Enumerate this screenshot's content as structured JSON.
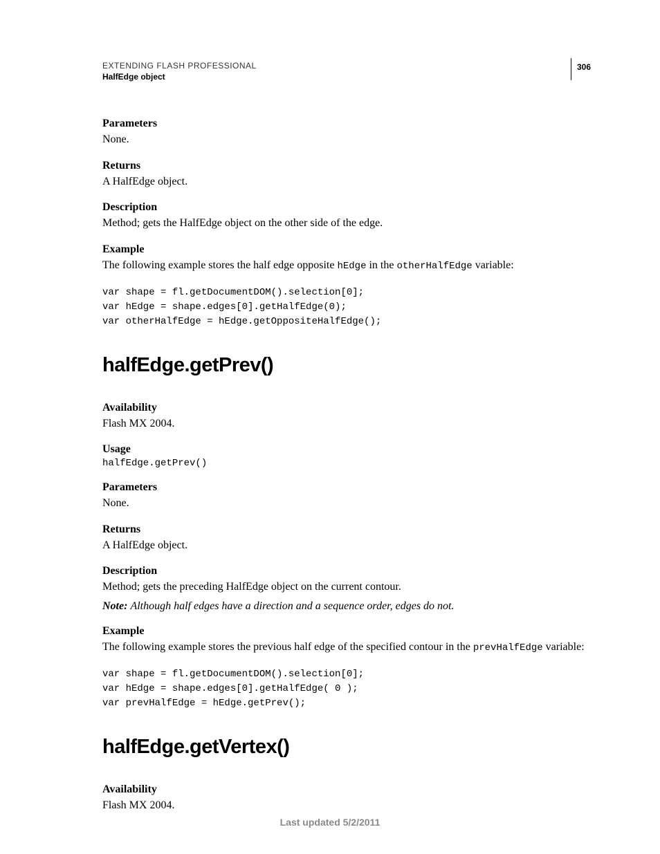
{
  "header": {
    "running_head": "EXTENDING FLASH PROFESSIONAL",
    "running_sub": "HalfEdge object",
    "page_number": "306"
  },
  "section1": {
    "parameters_label": "Parameters",
    "parameters_body": "None.",
    "returns_label": "Returns",
    "returns_body": "A HalfEdge object.",
    "description_label": "Description",
    "description_body": "Method; gets the HalfEdge object on the other side of the edge.",
    "example_label": "Example",
    "example_lead_pre": "The following example stores the half edge opposite ",
    "example_code1": "hEdge",
    "example_mid": " in the ",
    "example_code2": "otherHalfEdge",
    "example_post": " variable:",
    "code": "var shape = fl.getDocumentDOM().selection[0]; \nvar hEdge = shape.edges[0].getHalfEdge(0); \nvar otherHalfEdge = hEdge.getOppositeHalfEdge();"
  },
  "method2": {
    "title": "halfEdge.getPrev()",
    "availability_label": "Availability",
    "availability_body": "Flash MX 2004.",
    "usage_label": "Usage",
    "usage_code": "halfEdge.getPrev()",
    "parameters_label": "Parameters",
    "parameters_body": "None.",
    "returns_label": "Returns",
    "returns_body": "A HalfEdge object.",
    "description_label": "Description",
    "description_body": "Method; gets the preceding HalfEdge object on the current contour.",
    "note_label": "Note: ",
    "note_text": "Although half edges have a direction and a sequence order, edges do not.",
    "example_label": "Example",
    "example_lead_pre": "The following example stores the previous half edge of the specified contour in the ",
    "example_code1": "prevHalfEdge",
    "example_post": " variable:",
    "code": "var shape = fl.getDocumentDOM().selection[0]; \nvar hEdge = shape.edges[0].getHalfEdge( 0 ); \nvar prevHalfEdge = hEdge.getPrev();"
  },
  "method3": {
    "title": "halfEdge.getVertex()",
    "availability_label": "Availability",
    "availability_body": "Flash MX 2004."
  },
  "footer": {
    "text": "Last updated 5/2/2011"
  }
}
